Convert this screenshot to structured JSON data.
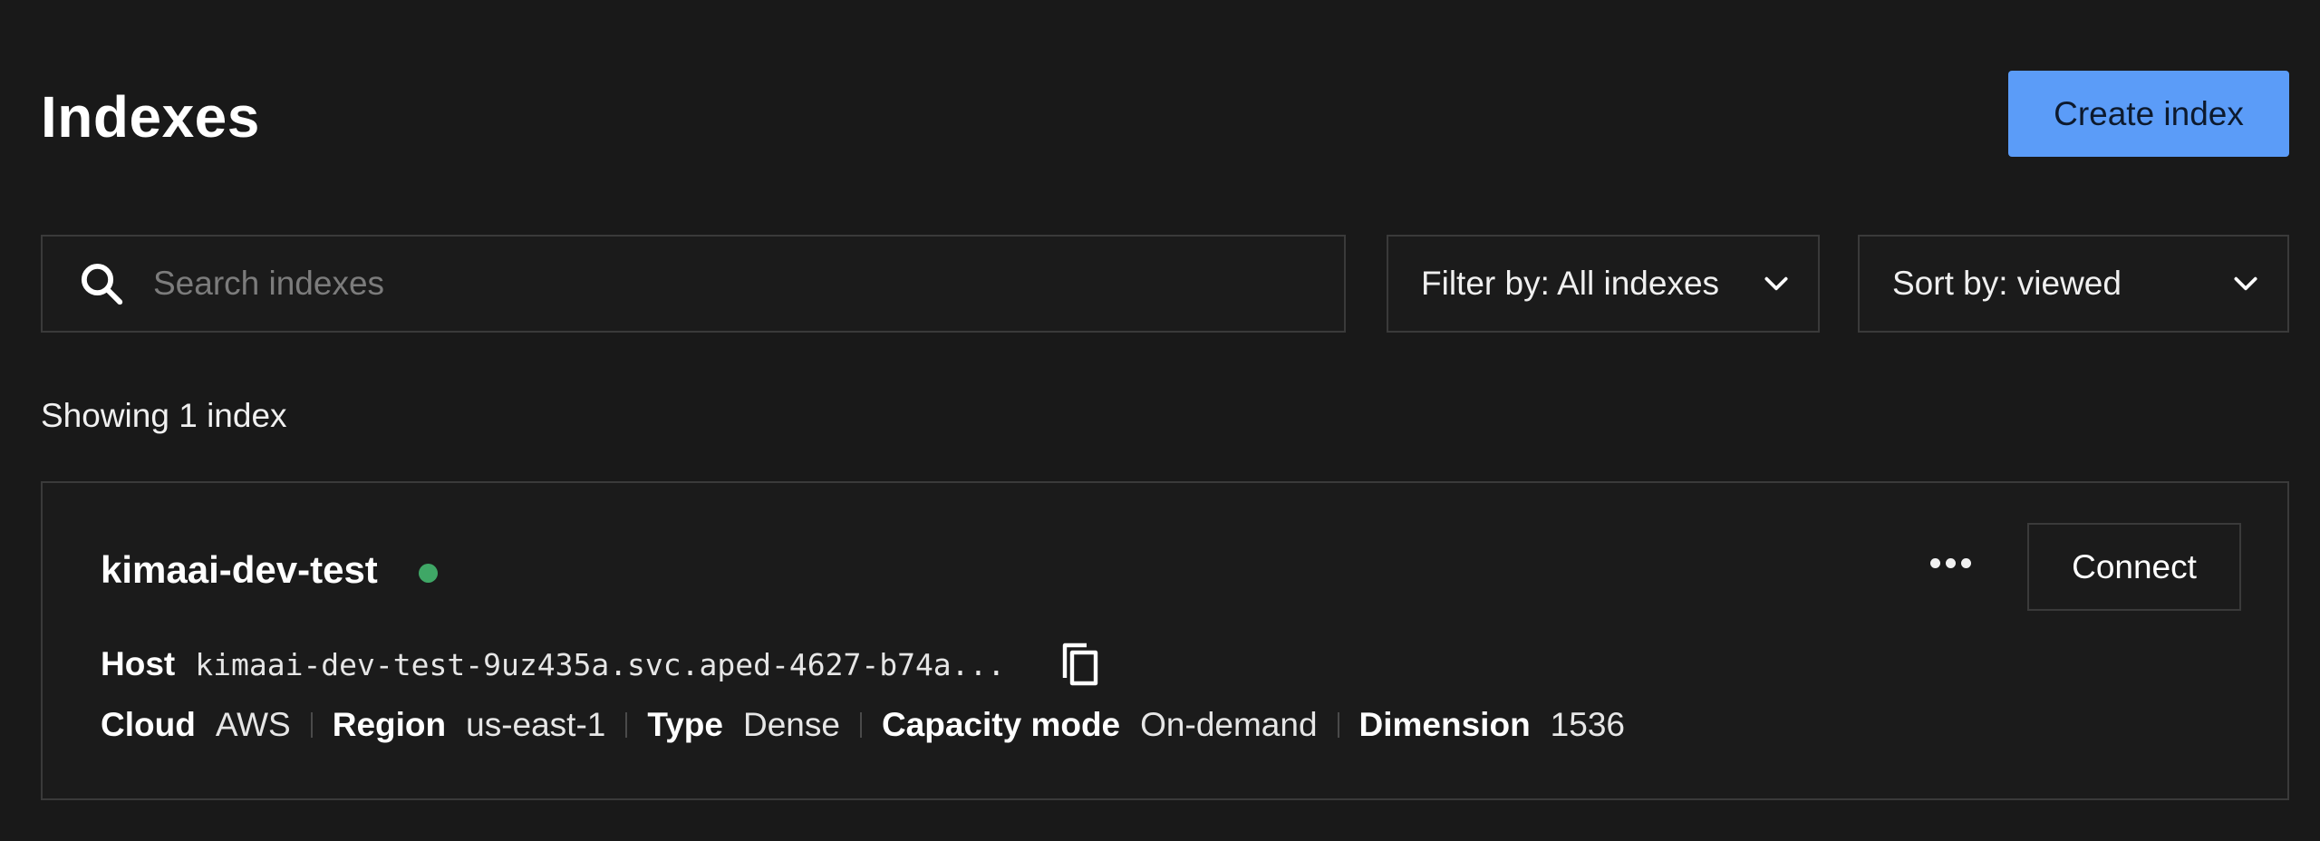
{
  "header": {
    "title": "Indexes",
    "create_label": "Create index"
  },
  "controls": {
    "search_placeholder": "Search indexes",
    "search_value": "",
    "filter_label": "Filter by: All indexes",
    "sort_label": "Sort by: viewed"
  },
  "summary": "Showing 1 index",
  "index": {
    "name": "kimaai-dev-test",
    "status_color": "#3fa766",
    "host_label": "Host",
    "host_value": "kimaai-dev-test-9uz435a.svc.aped-4627-b74a...",
    "connect_label": "Connect",
    "meta": {
      "cloud_label": "Cloud",
      "cloud_value": "AWS",
      "region_label": "Region",
      "region_value": "us-east-1",
      "type_label": "Type",
      "type_value": "Dense",
      "capacity_label": "Capacity mode",
      "capacity_value": "On-demand",
      "dimension_label": "Dimension",
      "dimension_value": "1536"
    }
  },
  "icons": {
    "search": "search-icon",
    "filter_chevron": "chevron-down-icon",
    "sort_chevron": "chevron-down-icon",
    "more": "more-horizontal-icon",
    "copy": "copy-icon"
  },
  "colors": {
    "background": "#191919",
    "accent": "#5b9cf8",
    "border": "#3a3a3a"
  }
}
